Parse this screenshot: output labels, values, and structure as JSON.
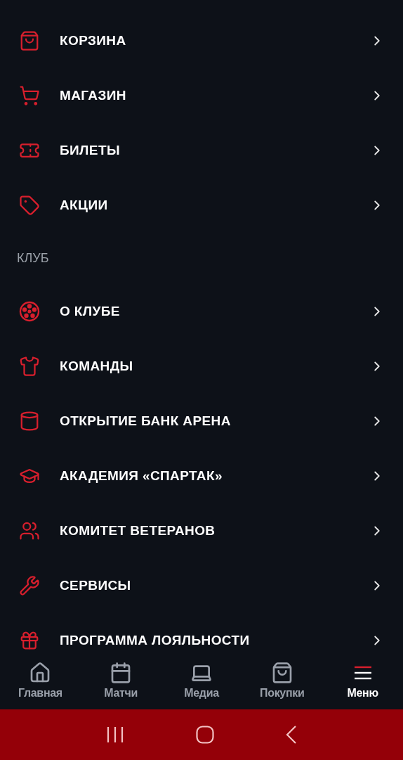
{
  "shop_items": [
    {
      "kind": "bag",
      "label": "КОРЗИНА"
    },
    {
      "kind": "cart",
      "label": "МАГАЗИН"
    },
    {
      "kind": "ticket",
      "label": "БИЛЕТЫ"
    },
    {
      "kind": "tag",
      "label": "АКЦИИ"
    }
  ],
  "club_section": {
    "title": "КЛУБ",
    "items": [
      {
        "kind": "ball",
        "label": "О КЛУБЕ"
      },
      {
        "kind": "shirt",
        "label": "КОМАНДЫ"
      },
      {
        "kind": "stadium",
        "label": "ОТКРЫТИЕ БАНК АРЕНА"
      },
      {
        "kind": "cap",
        "label": "АКАДЕМИЯ «СПАРТАК»"
      },
      {
        "kind": "people",
        "label": "КОМИТЕТ ВЕТЕРАНОВ"
      },
      {
        "kind": "wrench",
        "label": "СЕРВИСЫ"
      },
      {
        "kind": "gift",
        "label": "ПРОГРАММА ЛОЯЛЬНОСТИ"
      }
    ]
  },
  "tab_bar": [
    {
      "kind": "home",
      "label": "Главная",
      "selected": false
    },
    {
      "kind": "calendar",
      "label": "Матчи",
      "selected": false
    },
    {
      "kind": "media",
      "label": "Медиа",
      "selected": false
    },
    {
      "kind": "bag",
      "label": "Покупки",
      "selected": false
    },
    {
      "kind": "menu",
      "label": "Меню",
      "selected": true
    }
  ]
}
